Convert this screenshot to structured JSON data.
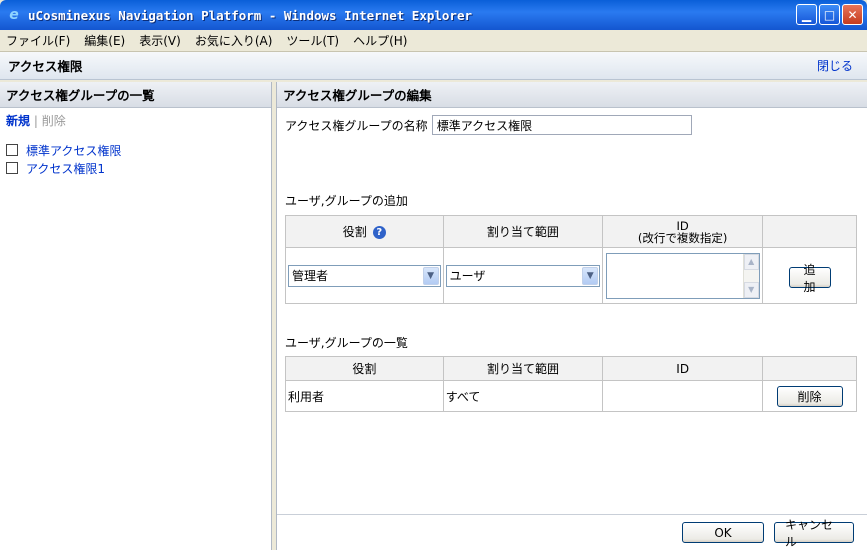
{
  "window": {
    "title": "uCosminexus Navigation Platform - Windows Internet Explorer"
  },
  "menu": [
    "ファイル(F)",
    "編集(E)",
    "表示(V)",
    "お気に入り(A)",
    "ツール(T)",
    "ヘルプ(H)"
  ],
  "page": {
    "title": "アクセス権限",
    "close_label": "閉じる"
  },
  "left": {
    "title": "アクセス権グループの一覧",
    "new_label": "新規",
    "separator": "|",
    "delete_label": "削除",
    "items": [
      "標準アクセス権限",
      "アクセス権限1"
    ]
  },
  "right": {
    "title": "アクセス権グループの編集",
    "name_label": "アクセス権グループの名称",
    "name_value": "標準アクセス権限",
    "add_section": "ユーザ,グループの追加",
    "add_headers": {
      "role": "役割",
      "scope": "割り当て範囲",
      "id_line1": "ID",
      "id_line2": "(改行で複数指定)"
    },
    "role_value": "管理者",
    "scope_value": "ユーザ",
    "add_button": "追加",
    "list_section": "ユーザ,グループの一覧",
    "list_headers": {
      "role": "役割",
      "scope": "割り当て範囲",
      "id": "ID"
    },
    "rows": [
      {
        "role": "利用者",
        "scope": "すべて",
        "id": "",
        "action": "削除"
      }
    ],
    "ok_label": "OK",
    "cancel_label": "キャンセル"
  }
}
